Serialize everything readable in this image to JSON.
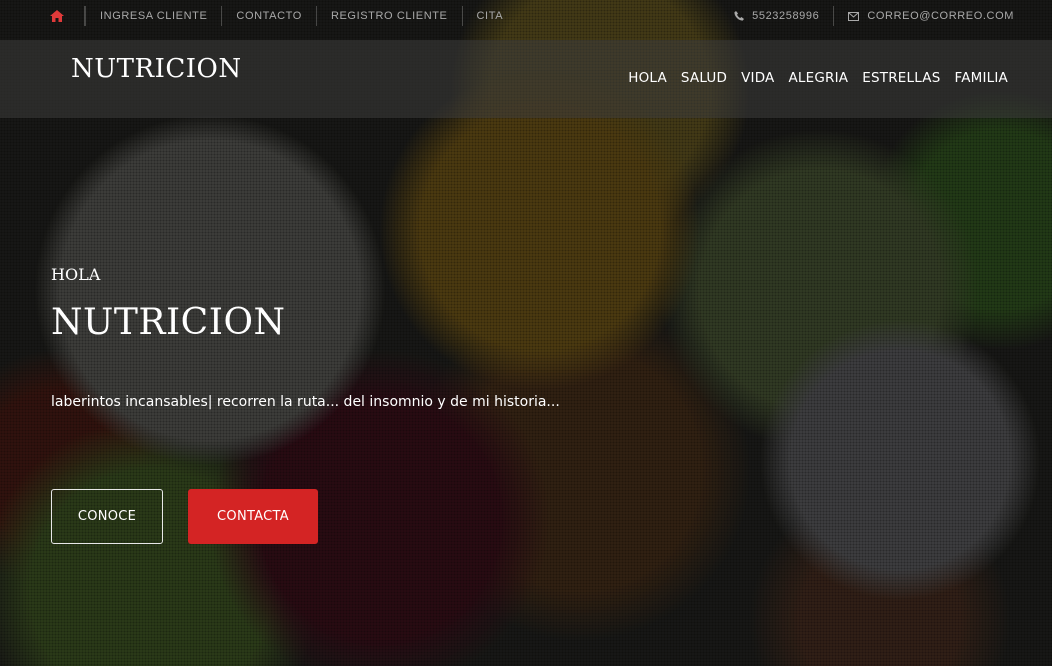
{
  "colors": {
    "accent": "#d42424",
    "home_icon": "#e03a3a"
  },
  "topbar": {
    "home_icon": "home-icon",
    "links": [
      "INGRESA CLIENTE",
      "CONTACTO",
      "REGISTRO CLIENTE",
      "CITA"
    ],
    "phone_icon": "phone-icon",
    "phone": "5523258996",
    "email_icon": "envelope-icon",
    "email": "CORREO@CORREO.COM"
  },
  "header": {
    "brand": "NUTRICION",
    "nav": [
      "HOLA",
      "SALUD",
      "VIDA",
      "ALEGRIA",
      "ESTRELLAS",
      "FAMILIA"
    ]
  },
  "hero": {
    "kicker": "HOLA",
    "title": "NUTRICION",
    "text": "laberintos incansables| recorren la ruta... del insomnio y de mi historia...",
    "primary_button": "CONOCE",
    "secondary_button": "CONTACTA"
  }
}
